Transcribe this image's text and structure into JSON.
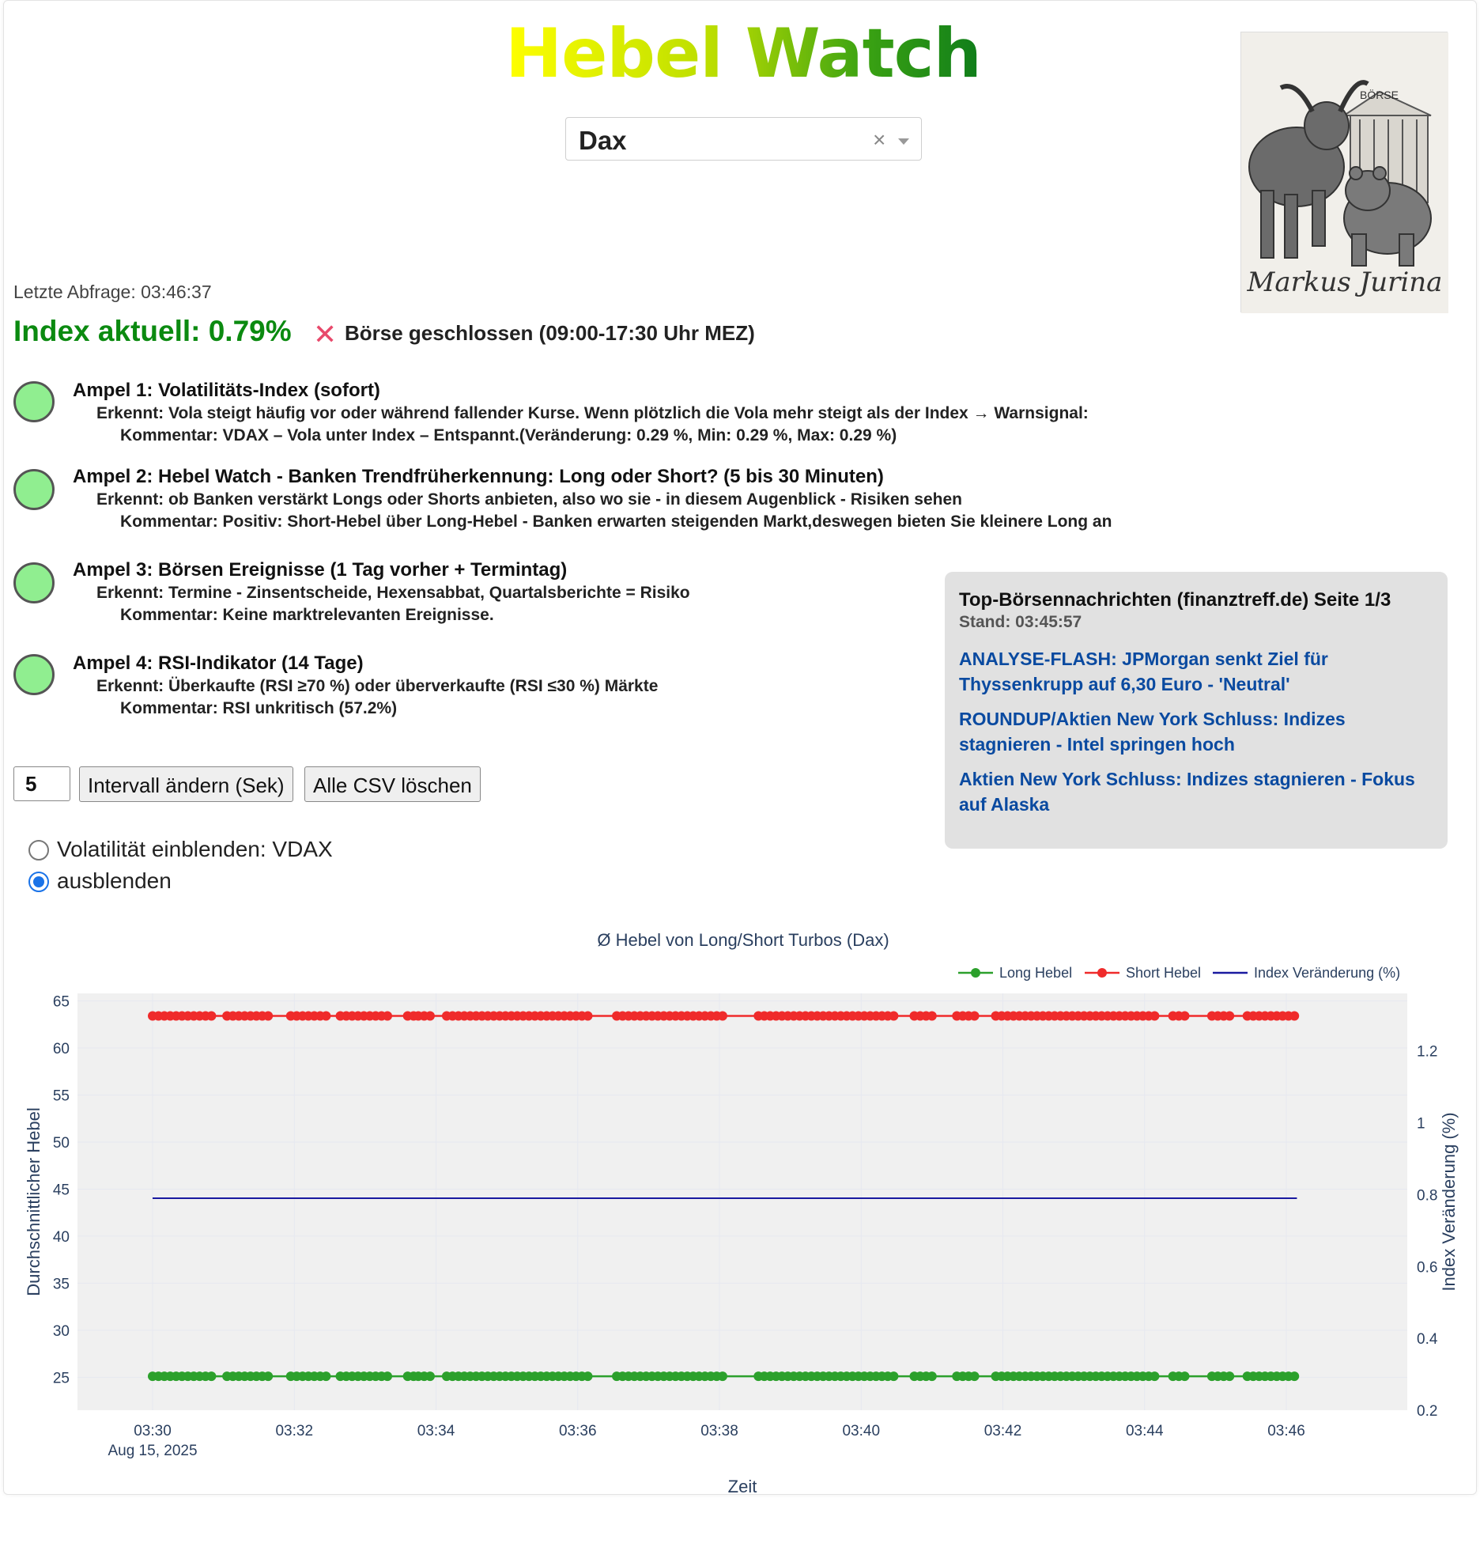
{
  "header": {
    "title_word1": "Hebel",
    "title_word2": "Watch",
    "select_value": "Dax",
    "clear_symbol": "×",
    "logo_signature": "Markus Jurina",
    "logo_sign_text": "BÖRSE"
  },
  "status": {
    "last_query": "Letzte Abfrage: 03:46:37",
    "index_current": "Index aktuell: 0.79%",
    "market_icon": "✕",
    "market_status": "Börse geschlossen (09:00-17:30 Uhr MEZ)"
  },
  "ampeln": [
    {
      "title": "Ampel 1: Volatilitäts-Index (sofort)",
      "erkennt": "Erkennt: Vola steigt häufig vor oder während fallender Kurse. Wenn plötzlich die Vola mehr steigt als der Index → Warnsignal:",
      "kommentar": "Kommentar: VDAX – Vola unter Index – Entspannt.(Veränderung: 0.29 %, Min: 0.29 %, Max: 0.29 %)",
      "color": "#90ee90"
    },
    {
      "title": "Ampel 2: Hebel Watch - Banken Trendfrüherkennung: Long oder Short? (5 bis 30 Minuten)",
      "erkennt": "Erkennt: ob Banken verstärkt Longs oder Shorts anbieten, also wo sie - in diesem Augenblick - Risiken sehen",
      "kommentar": "Kommentar: Positiv: Short-Hebel über Long-Hebel - Banken erwarten steigenden Markt,deswegen bieten Sie kleinere Long an",
      "color": "#90ee90"
    },
    {
      "title": "Ampel 3: Börsen Ereignisse (1 Tag vorher + Termintag)",
      "erkennt": "Erkennt: Termine - Zinsentscheide, Hexensabbat, Quartalsberichte = Risiko",
      "kommentar": "Kommentar: Keine marktrelevanten Ereignisse.",
      "color": "#90ee90"
    },
    {
      "title": "Ampel 4: RSI-Indikator (14 Tage)",
      "erkennt": "Erkennt: Überkaufte (RSI ≥70 %) oder überverkaufte (RSI ≤30 %) Märkte",
      "kommentar": "Kommentar: RSI unkritisch (57.2%)",
      "color": "#90ee90"
    }
  ],
  "news": {
    "heading": "Top-Börsennachrichten (finanztreff.de) Seite 1/3",
    "stand": "Stand: 03:45:57",
    "items": [
      "ANALYSE-FLASH: JPMorgan senkt Ziel für Thyssenkrupp auf 6,30 Euro - 'Neutral'",
      "ROUNDUP/Aktien New York Schluss: Indizes stagnieren - Intel springen hoch",
      "Aktien New York Schluss: Indizes stagnieren - Fokus auf Alaska"
    ]
  },
  "controls": {
    "interval_value": "5",
    "interval_button": "Intervall ändern (Sek)",
    "delete_button": "Alle CSV löschen",
    "radio_show": "Volatilität einblenden: VDAX",
    "radio_hide": "ausblenden",
    "radio_selected": "hide"
  },
  "chart_data": {
    "type": "line",
    "title": "Ø Hebel von Long/Short Turbos (Dax)",
    "xlabel": "Zeit",
    "ylabel": "Durchschnittlicher Hebel",
    "y2label": "Index Veränderung (%)",
    "x_ticks": [
      "03:30",
      "03:32",
      "03:34",
      "03:36",
      "03:38",
      "03:40",
      "03:42",
      "03:44",
      "03:46"
    ],
    "x_date": "Aug 15, 2025",
    "x_range_minutes": [
      0,
      17.4
    ],
    "ylim": [
      21.5,
      65.8
    ],
    "y_ticks": [
      25,
      30,
      35,
      40,
      45,
      50,
      55,
      60,
      65
    ],
    "y2lim": [
      0.2,
      1.36
    ],
    "y2_ticks": [
      0.2,
      0.4,
      0.6,
      0.8,
      1,
      1.2
    ],
    "legend": [
      "Long Hebel",
      "Short Hebel",
      "Index Veränderung (%)"
    ],
    "legend_position": "top-right",
    "series": [
      {
        "name": "Long Hebel",
        "color": "#2ca02c",
        "axis": "y",
        "constant": 25.1,
        "segments": [
          [
            0.0,
            0.9
          ],
          [
            1.05,
            1.65
          ],
          [
            1.95,
            2.5
          ],
          [
            2.65,
            3.35
          ],
          [
            3.6,
            3.7
          ],
          [
            3.75,
            3.95
          ],
          [
            4.15,
            6.15
          ],
          [
            6.55,
            8.1
          ],
          [
            8.55,
            10.5
          ],
          [
            10.75,
            11.05
          ],
          [
            11.35,
            11.65
          ],
          [
            11.9,
            14.15
          ],
          [
            14.4,
            14.6
          ],
          [
            14.95,
            15.25
          ],
          [
            15.45,
            16.15
          ]
        ]
      },
      {
        "name": "Short Hebel",
        "color": "#ef2b2b",
        "axis": "y",
        "constant": 63.4,
        "segments": [
          [
            0.0,
            0.9
          ],
          [
            1.05,
            1.65
          ],
          [
            1.95,
            2.5
          ],
          [
            2.65,
            3.35
          ],
          [
            3.6,
            3.7
          ],
          [
            3.75,
            3.95
          ],
          [
            4.15,
            6.15
          ],
          [
            6.55,
            8.1
          ],
          [
            8.55,
            10.5
          ],
          [
            10.75,
            11.05
          ],
          [
            11.35,
            11.65
          ],
          [
            11.9,
            14.15
          ],
          [
            14.4,
            14.6
          ],
          [
            14.95,
            15.25
          ],
          [
            15.45,
            16.15
          ]
        ]
      },
      {
        "name": "Index Veränderung (%)",
        "color": "#1a1aa0",
        "axis": "y2",
        "constant": 0.79,
        "segments": [
          [
            0.0,
            16.15
          ]
        ]
      }
    ],
    "grid": true
  }
}
